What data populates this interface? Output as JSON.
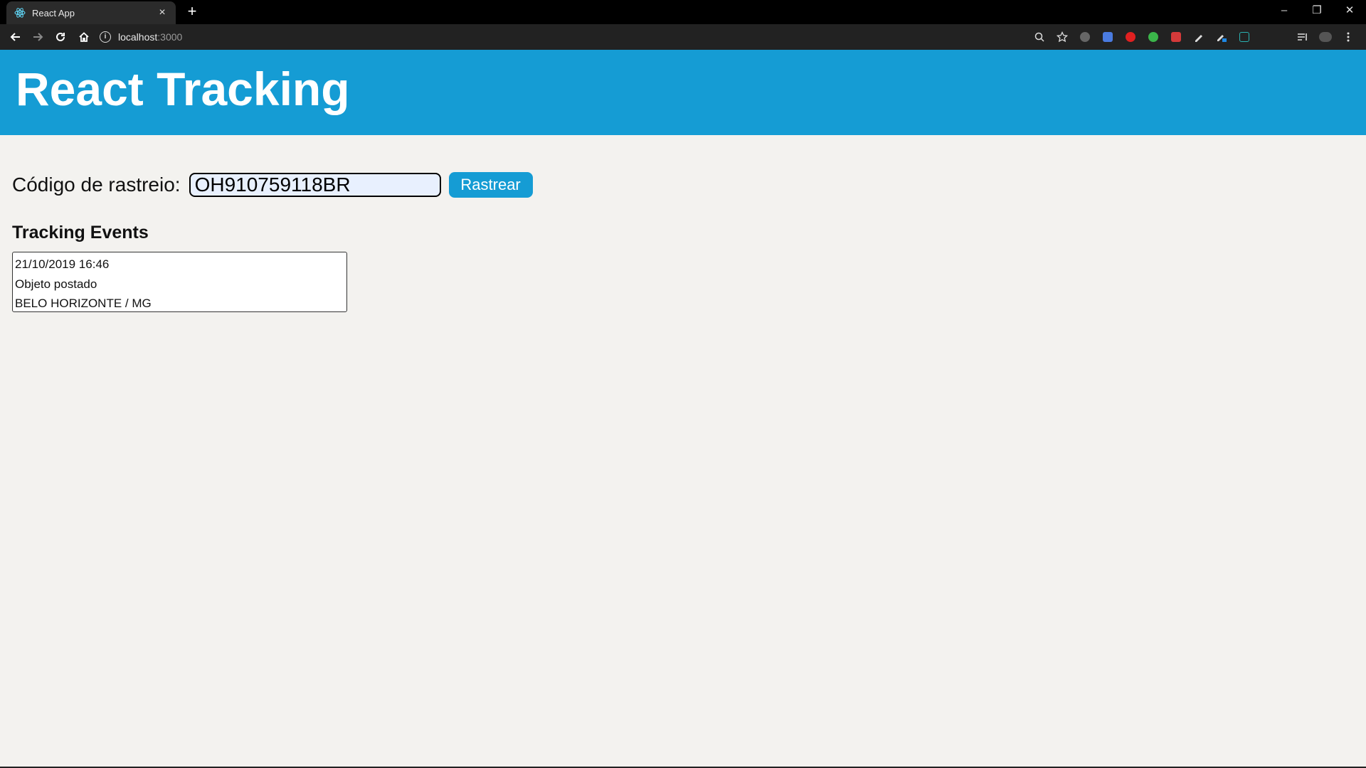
{
  "browser": {
    "tab_title": "React App",
    "tab_close": "×",
    "new_tab": "+",
    "url_host": "localhost",
    "url_port": ":3000",
    "window_controls": {
      "minimize": "–",
      "restore": "❐",
      "close": "✕"
    }
  },
  "app": {
    "title": "React Tracking",
    "form": {
      "label": "Código de rastreio:",
      "input_value": "OH910759118BR",
      "button_label": "Rastrear"
    },
    "events_heading": "Tracking Events",
    "events": [
      {
        "datetime": "21/10/2019 16:46",
        "status": "Objeto postado",
        "location": "BELO HORIZONTE / MG"
      }
    ]
  },
  "colors": {
    "header": "#159cd4",
    "page_background": "#f3f2ef",
    "input_background": "#e8f0fe"
  }
}
